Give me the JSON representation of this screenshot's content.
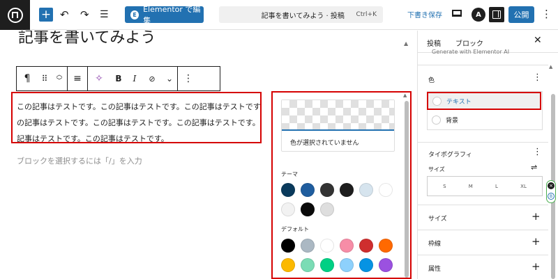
{
  "topbar": {
    "elementor_button": "Elementor で編集",
    "elementor_logo": "E",
    "document_title": "記事を書いてみよう · 投稿",
    "document_shortcut": "Ctrl+K",
    "save_draft": "下書き保存",
    "astra_label": "A",
    "publish": "公開",
    "icons": [
      "wordpress-logo-icon",
      "plus-icon",
      "undo-icon",
      "redo-icon",
      "document-overview-icon",
      "preview-icon",
      "settings-panel-icon",
      "more-vertical-icon"
    ]
  },
  "editor": {
    "post_title": "記事を書いてみよう",
    "block_toolbar": {
      "paragraph_icon": "¶",
      "drag_icon": "⠿",
      "align_icon": "≡",
      "ai_icon": "✧",
      "bold": "B",
      "italic": "I",
      "link_icon": "⊘",
      "chevron": "⌄",
      "more": "⋮"
    },
    "paragraph": "この記事はテストです。この記事はテストです。この記事はテストです。この記事はテストです。この記事はテストです。この記事はテストです。この記事はテストです。この記事はテストです。",
    "placeholder": "ブロックを選択するには「/」を入力"
  },
  "color_popover": {
    "no_color_text": "色が選択されていません",
    "theme_title": "テーマ",
    "default_title": "デフォルト",
    "theme_colors": [
      [
        "#0a3a5c",
        "#1f5d9e",
        "#333333",
        "#1e1e1e",
        "#d6e4ee",
        "#ffffff"
      ],
      [
        "#f2f2f2",
        "#0a0a0a",
        "#dedede"
      ]
    ],
    "default_colors": [
      [
        "#000000",
        "#abb8c3",
        "#ffffff",
        "#f78da7",
        "#cf2e2e",
        "#ff6900"
      ],
      [
        "#fcb900",
        "#7bdcb5",
        "#00d084",
        "#8ed1fc",
        "#0693e3",
        "#9b51e0"
      ]
    ]
  },
  "sidebar": {
    "tab_post": "投稿",
    "tab_block": "ブロック",
    "cut_text": "Generate with Elementor AI",
    "color_heading": "色",
    "color_text_option": "テキスト",
    "color_background_option": "背景",
    "typography_heading": "タイポグラフィ",
    "size_label": "サイズ",
    "sizes": [
      "S",
      "M",
      "L",
      "XL"
    ],
    "size_heading": "サイズ",
    "border_heading": "枠線",
    "attributes_heading": "属性",
    "accent_color": "#2271b1",
    "highlight_color": "#d50000"
  }
}
